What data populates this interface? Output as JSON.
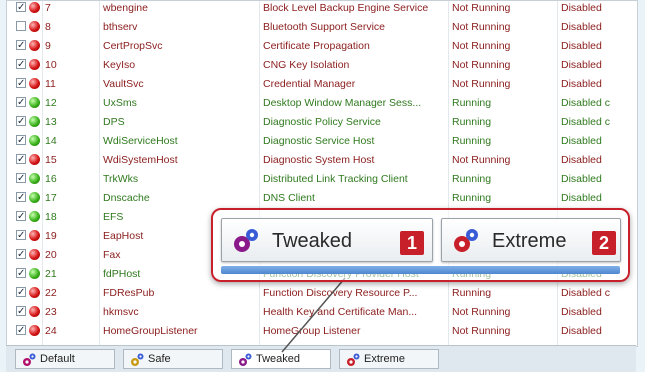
{
  "rows": [
    {
      "num": "7",
      "name": "wbengine",
      "display": "Block Level Backup Engine Service",
      "status": "Not Running",
      "startup": "Disabled",
      "checked": true,
      "state": "red"
    },
    {
      "num": "8",
      "name": "bthserv",
      "display": "Bluetooth Support Service",
      "status": "Not Running",
      "startup": "Disabled",
      "checked": false,
      "state": "red"
    },
    {
      "num": "9",
      "name": "CertPropSvc",
      "display": "Certificate Propagation",
      "status": "Not Running",
      "startup": "Disabled",
      "checked": true,
      "state": "red"
    },
    {
      "num": "10",
      "name": "KeyIso",
      "display": "CNG Key Isolation",
      "status": "Not Running",
      "startup": "Disabled",
      "checked": true,
      "state": "red"
    },
    {
      "num": "11",
      "name": "VaultSvc",
      "display": "Credential Manager",
      "status": "Not Running",
      "startup": "Disabled",
      "checked": true,
      "state": "red"
    },
    {
      "num": "12",
      "name": "UxSms",
      "display": "Desktop Window Manager Sess...",
      "status": "Running",
      "startup": "Disabled c",
      "checked": true,
      "state": "green"
    },
    {
      "num": "13",
      "name": "DPS",
      "display": "Diagnostic Policy Service",
      "status": "Running",
      "startup": "Disabled c",
      "checked": true,
      "state": "green"
    },
    {
      "num": "14",
      "name": "WdiServiceHost",
      "display": "Diagnostic Service Host",
      "status": "Running",
      "startup": "Disabled",
      "checked": true,
      "state": "green"
    },
    {
      "num": "15",
      "name": "WdiSystemHost",
      "display": "Diagnostic System Host",
      "status": "Not Running",
      "startup": "Disabled",
      "checked": true,
      "state": "red"
    },
    {
      "num": "16",
      "name": "TrkWks",
      "display": "Distributed Link Tracking Client",
      "status": "Running",
      "startup": "Disabled",
      "checked": true,
      "state": "green"
    },
    {
      "num": "17",
      "name": "Dnscache",
      "display": "DNS Client",
      "status": "Running",
      "startup": "Disabled",
      "checked": true,
      "state": "green"
    },
    {
      "num": "18",
      "name": "EFS",
      "display": "",
      "status": "",
      "startup": "",
      "checked": true,
      "state": "green"
    },
    {
      "num": "19",
      "name": "EapHost",
      "display": "",
      "status": "",
      "startup": "",
      "checked": true,
      "state": "red"
    },
    {
      "num": "20",
      "name": "Fax",
      "display": "",
      "status": "",
      "startup": "",
      "checked": true,
      "state": "red"
    },
    {
      "num": "21",
      "name": "fdPHost",
      "display": "Function Discovery Provider Host",
      "status": "Running",
      "startup": "Disabled",
      "checked": true,
      "state": "green"
    },
    {
      "num": "22",
      "name": "FDResPub",
      "display": "Function Discovery Resource P...",
      "status": "Running",
      "startup": "Disabled c",
      "checked": true,
      "state": "red"
    },
    {
      "num": "23",
      "name": "hkmsvc",
      "display": "Health Key and Certificate Man...",
      "status": "Not Running",
      "startup": "Disabled",
      "checked": true,
      "state": "red"
    },
    {
      "num": "24",
      "name": "HomeGroupListener",
      "display": "HomeGroup Listener",
      "status": "Not Running",
      "startup": "Disabled",
      "checked": true,
      "state": "red"
    }
  ],
  "tabs": [
    {
      "label": "Default"
    },
    {
      "label": "Safe"
    },
    {
      "label": "Tweaked"
    },
    {
      "label": "Extreme"
    }
  ],
  "callout": {
    "tweaked_label": "Tweaked",
    "tweaked_badge": "1",
    "extreme_label": "Extreme",
    "extreme_badge": "2"
  },
  "colors": {
    "accent": "#c8202b",
    "running": "#2f7a1e",
    "stopped": "#8b1d1d"
  }
}
